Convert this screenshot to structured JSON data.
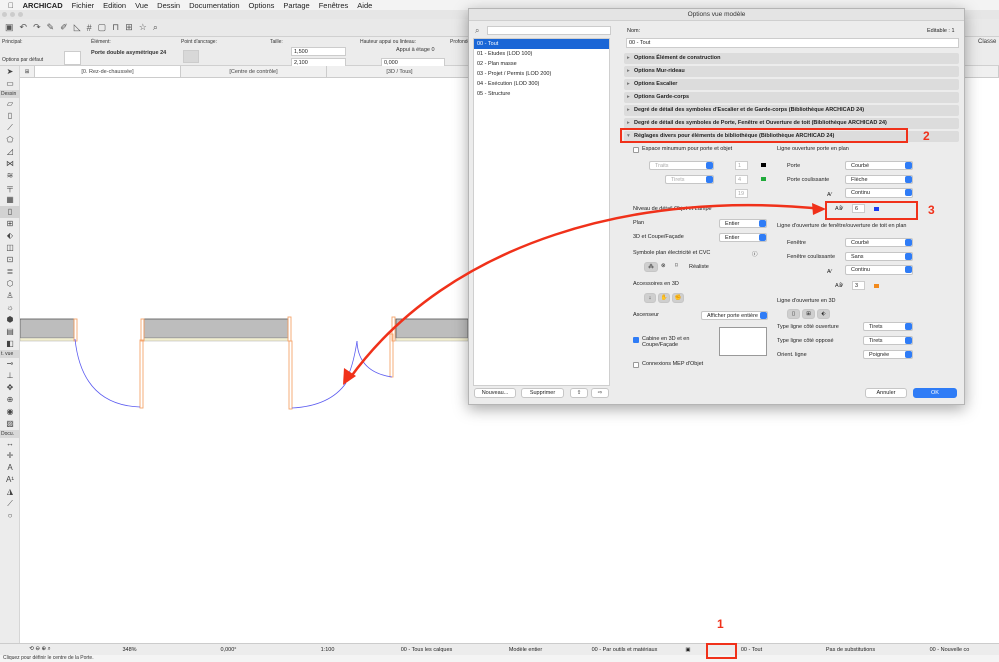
{
  "menubar": {
    "apple": "",
    "app": "ARCHICAD",
    "items": [
      "Fichier",
      "Edition",
      "Vue",
      "Dessin",
      "Documentation",
      "Options",
      "Partage",
      "Fenêtres",
      "Aide"
    ]
  },
  "infobox": {
    "principal_label": "Principal:",
    "principal_value": "Options par défaut",
    "element_label": "Élément:",
    "element_value": "Porte double asymétrique 24",
    "anchor_label": "Point d'ancrage:",
    "size_label": "Taille:",
    "width": "1,500",
    "height": "2,100",
    "sill_label": "Hauteur appui ou linteau:",
    "sill_ref": "Appui à étage 0",
    "sill_value": "0,000",
    "depth_label": "Profonde",
    "class_label": "Classe"
  },
  "tabs": [
    "[0. Rez-de-chaussée]",
    "[Centre de contrôle]",
    "[3D / Tous]"
  ],
  "lefttools": {
    "dessin": "Dessin",
    "vue": "t. vue",
    "docu": "Docu."
  },
  "status": {
    "zoom": "348%",
    "angle": "0,000°",
    "scale": "1:100",
    "layers": "00 - Tous les calques",
    "model": "Modèle entier",
    "pens": "00 - Par outils et matériaux",
    "mvo": "00 - Tout",
    "overrides": "Pas de substitutions",
    "renovation": "00 - Nouvelle co"
  },
  "hint": "Cliquez pour définir le centre de la Porte.",
  "dialog": {
    "title": "Options vue modèle",
    "list": [
      "00 - Tout",
      "01 - Etudes (LOD 100)",
      "02 - Plan masse",
      "03 - Projet / Permis (LOD 200)",
      "04 - Exécution (LOD 300)",
      "05 - Structure"
    ],
    "new_btn": "Nouveau...",
    "delete_btn": "Supprimer",
    "name_label": "Nom:",
    "editable": "Editable : 1",
    "name_value": "00 - Tout",
    "sections": [
      "Options Élément de construction",
      "Options Mur-rideau",
      "Options Escalier",
      "Options Garde-corps",
      "Degré de détail des symboles d'Escalier et de Garde-corps (Bibliothèque ARCHICAD 24)",
      "Degré de détail des symboles de Porte, Fenêtre et Ouverture de toit (Bibliothèque ARCHICAD 24)",
      "Réglages divers pour éléments de bibliothèque (Bibliothèque ARCHICAD 24)"
    ],
    "left": {
      "min_space": "Espace minumum pour porte et objet",
      "line_type": "Traits",
      "fill_type": "Tirets",
      "pen1": "1",
      "pen2": "4",
      "pen3": "19",
      "detail_title": "Niveau de détail Objet et Lampe",
      "plan_label": "Plan",
      "plan_value": "Entier",
      "section_label": "3D et Coupe/Façade",
      "section_value": "Entier",
      "elec_label": "Symbole plan électricité et CVC",
      "elec_value": "Réaliste",
      "acc_label": "Accessoires en 3D",
      "elev_label": "Ascenseur",
      "elev_value": "Afficher porte entière",
      "cabin_label": "Cabine en 3D et en Coupe/Façade",
      "mep_label": "Connexions MEP d'Objet"
    },
    "right": {
      "door_title": "Ligne ouverture porte en plan",
      "door_label": "Porte",
      "door_value": "Courbé",
      "sliding_label": "Porte coulissante",
      "sliding_value": "Flèche",
      "door_line": "Continu",
      "door_pen": "6",
      "win_title": "Ligne d'ouverture de fenêtre/ouverture de toit en plan",
      "win_label": "Fenêtre",
      "win_value": "Courbé",
      "winslide_label": "Fenêtre coulissante",
      "winslide_value": "Sans",
      "win_line": "Continu",
      "win_pen": "3",
      "open3d_title": "Ligne d'ouverture en 3D",
      "open_side_label": "Type ligne côté ouverture",
      "open_side_value": "Tirets",
      "opp_side_label": "Type ligne côté opposé",
      "opp_side_value": "Tirets",
      "orient_label": "Orient. ligne",
      "orient_value": "Poignée"
    },
    "cancel": "Annuler",
    "ok": "OK"
  },
  "colors": {
    "door_pen": "#1a3cf0",
    "win_pen": "#f28a1c",
    "pen4": "#1faa3a",
    "accent": "#2f7cf6",
    "annotation": "#f0311a"
  },
  "annotations": [
    "1",
    "2",
    "3"
  ]
}
